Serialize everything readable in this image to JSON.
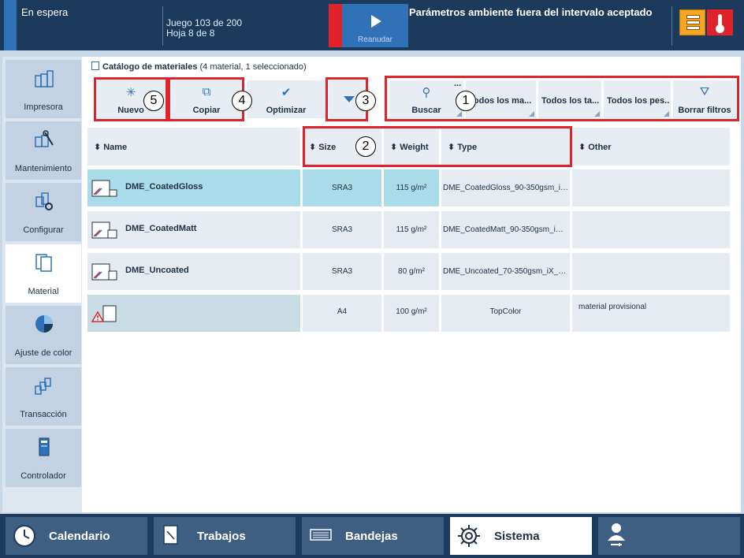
{
  "topbar": {
    "status": "En espera",
    "job": "Juego 103 de 200",
    "sheet": "Hoja 8 de 8",
    "resume_label": "Reanudar",
    "alert": "Parámetros ambiente fuera del intervalo aceptado",
    "status_color": "#2f72b8",
    "alert_color": "#e0232b",
    "warning_color": "#f5a623"
  },
  "sidebar": {
    "items": [
      {
        "label": "Impresora",
        "icon": "printer-icon"
      },
      {
        "label": "Mantenimiento",
        "icon": "maintenance-icon"
      },
      {
        "label": "Configurar",
        "icon": "configure-icon"
      },
      {
        "label": "Material",
        "icon": "material-icon",
        "active": true
      },
      {
        "label": "Ajuste de color",
        "icon": "color-icon"
      },
      {
        "label": "Transacción",
        "icon": "transaction-icon"
      },
      {
        "label": "Controlador",
        "icon": "controller-icon"
      }
    ]
  },
  "catalog": {
    "title": "Catálogo de materiales",
    "subtitle": "(4 material, 1 seleccionado)"
  },
  "toolbar": {
    "new": "Nuevo",
    "copy": "Copiar",
    "optimize": "Optimizar",
    "search": "Buscar",
    "more": "...",
    "filter_all_media": "Todos los ma...",
    "filter_all_sizes": "Todos los ta...",
    "filter_all_weights": "Todos los pes...",
    "clear_filters": "Borrar filtros"
  },
  "table": {
    "columns": {
      "name": "Name",
      "size": "Size",
      "weight": "Weight",
      "type": "Type",
      "other": "Other"
    },
    "rows": [
      {
        "name": "DME_CoatedGloss",
        "size": "SRA3",
        "weight": "115 g/m²",
        "type": "DME_CoatedGloss_90-350gsm_iX...",
        "other": ""
      },
      {
        "name": "DME_CoatedMatt",
        "size": "SRA3",
        "weight": "115 g/m²",
        "type": "DME_CoatedMatt_90-350gsm_iX_...",
        "other": ""
      },
      {
        "name": "DME_Uncoated",
        "size": "SRA3",
        "weight": "80 g/m²",
        "type": "DME_Uncoated_70-350gsm_iX_R4...",
        "other": ""
      },
      {
        "name": "",
        "size": "A4",
        "weight": "100 g/m²",
        "type": "TopColor",
        "other": "material provisional"
      }
    ]
  },
  "callouts": {
    "c1": "1",
    "c2": "2",
    "c3": "3",
    "c4": "4",
    "c5": "5"
  },
  "bottom_nav": {
    "calendar": "Calendario",
    "jobs": "Trabajos",
    "trays": "Bandejas",
    "system": "Sistema"
  }
}
